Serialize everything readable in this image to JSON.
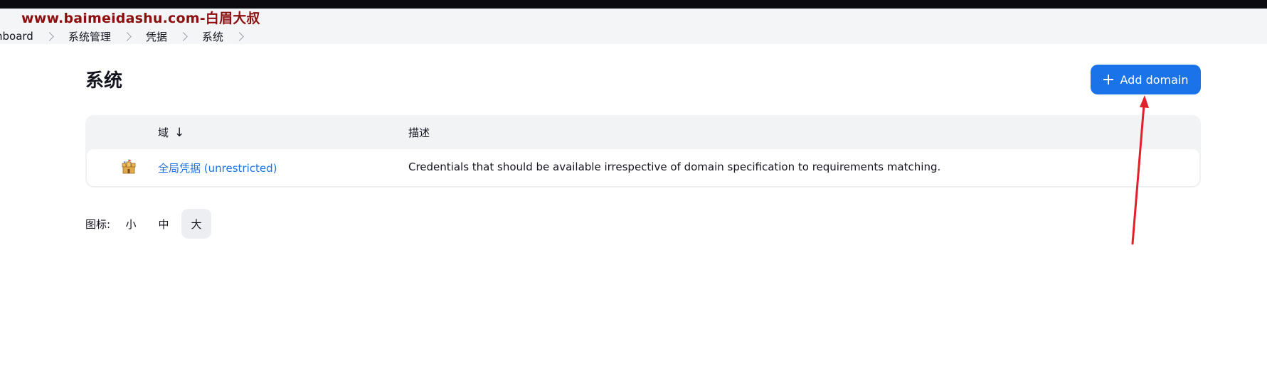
{
  "watermark": "www.baimeidashu.com-白眉大叔",
  "breadcrumb": {
    "items": [
      "nboard",
      "系统管理",
      "凭据",
      "系统"
    ]
  },
  "page": {
    "title": "系统"
  },
  "toolbar": {
    "add_domain_label": "Add domain",
    "add_icon": "plus-icon"
  },
  "table": {
    "headers": {
      "domain": "域",
      "sort_indicator": "↓",
      "description": "描述"
    },
    "rows": [
      {
        "icon": "castle-icon",
        "domain": "全局凭据 (unrestricted)",
        "description": "Credentials that should be available irrespective of domain specification to requirements matching."
      }
    ]
  },
  "icon_size": {
    "label": "图标:",
    "options": [
      "小",
      "中",
      "大"
    ],
    "selected": "大"
  },
  "colors": {
    "accent": "#1a73e8",
    "annotation_arrow": "#e0202a",
    "watermark": "#8c0f0f"
  }
}
